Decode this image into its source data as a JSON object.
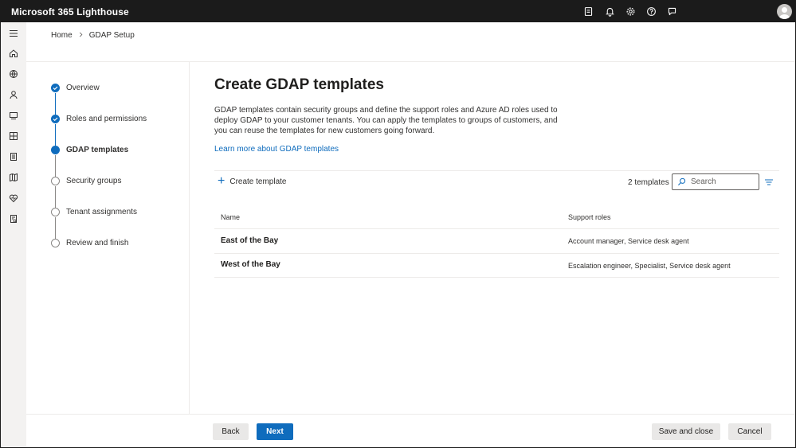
{
  "app": {
    "title": "Microsoft 365 Lighthouse"
  },
  "topbar": {
    "icons": [
      "feedback-list-icon",
      "bell-icon",
      "gear-icon",
      "help-icon",
      "chat-feedback-icon",
      "avatar"
    ]
  },
  "rail": {
    "icons": [
      "hamburger-icon",
      "home-icon",
      "tenants-globe-icon",
      "users-icon",
      "devices-icon",
      "dashboard-icon",
      "reports-icon",
      "map-icon",
      "health-heart-icon",
      "audit-log-icon"
    ]
  },
  "breadcrumb": {
    "home": "Home",
    "current": "GDAP Setup"
  },
  "steps": [
    {
      "label": "Overview",
      "state": "done"
    },
    {
      "label": "Roles and permissions",
      "state": "done"
    },
    {
      "label": "GDAP templates",
      "state": "current"
    },
    {
      "label": "Security groups",
      "state": "todo"
    },
    {
      "label": "Tenant assignments",
      "state": "todo"
    },
    {
      "label": "Review and finish",
      "state": "todo"
    }
  ],
  "main": {
    "title": "Create GDAP templates",
    "description": "GDAP templates contain security groups and define the support roles and Azure AD roles used to deploy GDAP to your customer tenants. You can apply the templates to groups of customers, and you can reuse the templates for new customers going forward.",
    "learn_more": "Learn more about GDAP templates",
    "create_label": "Create template",
    "count_label": "2 templates",
    "search_placeholder": "Search"
  },
  "table": {
    "columns": [
      "Name",
      "Support roles"
    ],
    "rows": [
      {
        "name": "East of the Bay",
        "roles": "Account manager, Service desk agent"
      },
      {
        "name": "West of the Bay",
        "roles": "Escalation engineer, Specialist, Service desk agent"
      }
    ]
  },
  "footer": {
    "back": "Back",
    "next": "Next",
    "save_close": "Save and close",
    "cancel": "Cancel"
  },
  "colors": {
    "accent": "#0f6cbd",
    "topbar": "#1b1b1b",
    "rail": "#f3f2f1"
  }
}
